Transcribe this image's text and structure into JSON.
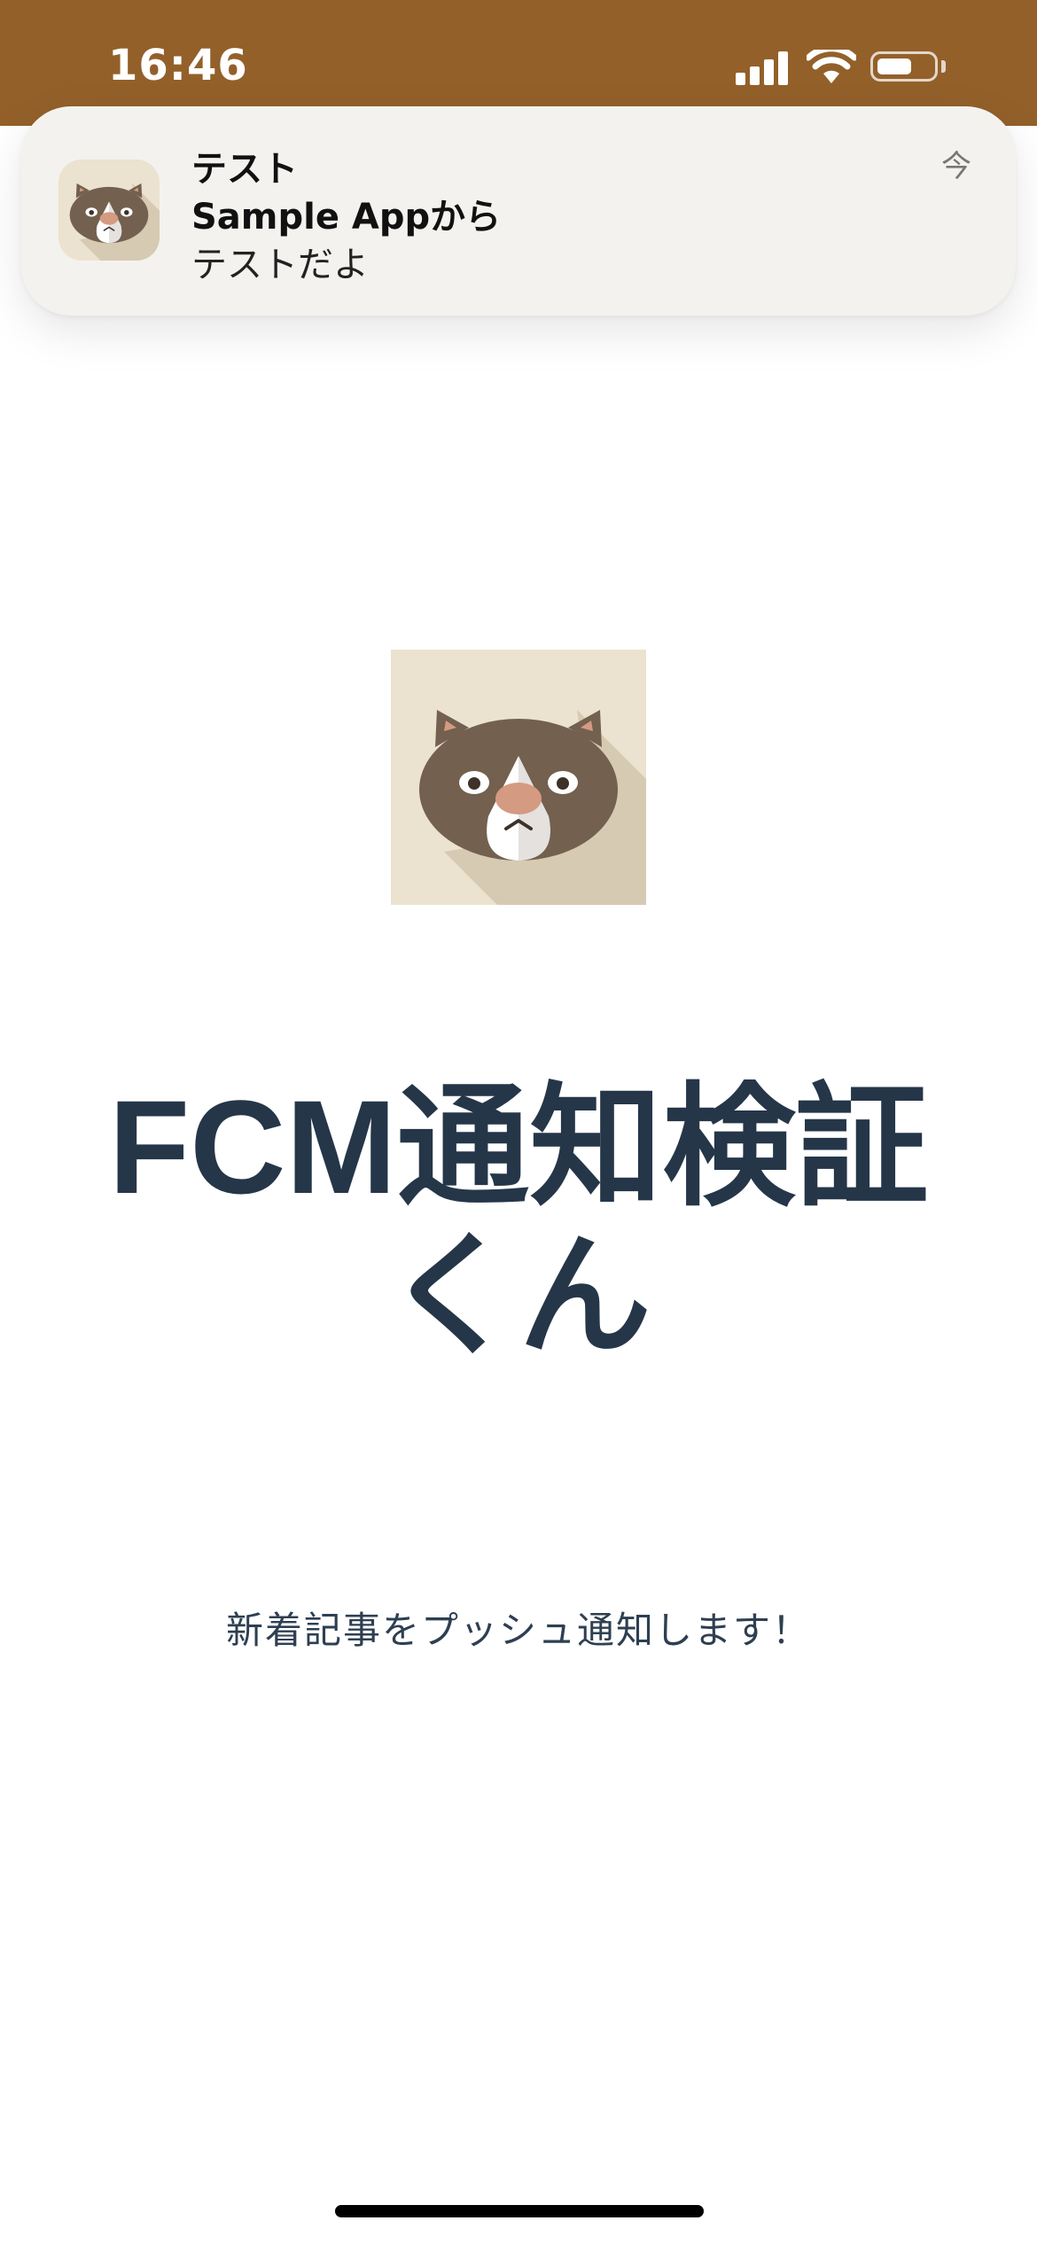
{
  "status_bar": {
    "time": "16:46",
    "background_color": "#93602a",
    "icons": [
      "cellular-signal-icon",
      "wifi-icon",
      "battery-icon"
    ]
  },
  "notification": {
    "title": "テスト",
    "source": "Sample Appから",
    "body": "テストだよ",
    "time": "今",
    "app_icon": "cat-face-icon"
  },
  "main": {
    "logo_icon": "cat-face-icon",
    "title": "FCM通知検証くん",
    "subtitle": "新着記事をプッシュ通知します！",
    "title_color": "#253649"
  }
}
